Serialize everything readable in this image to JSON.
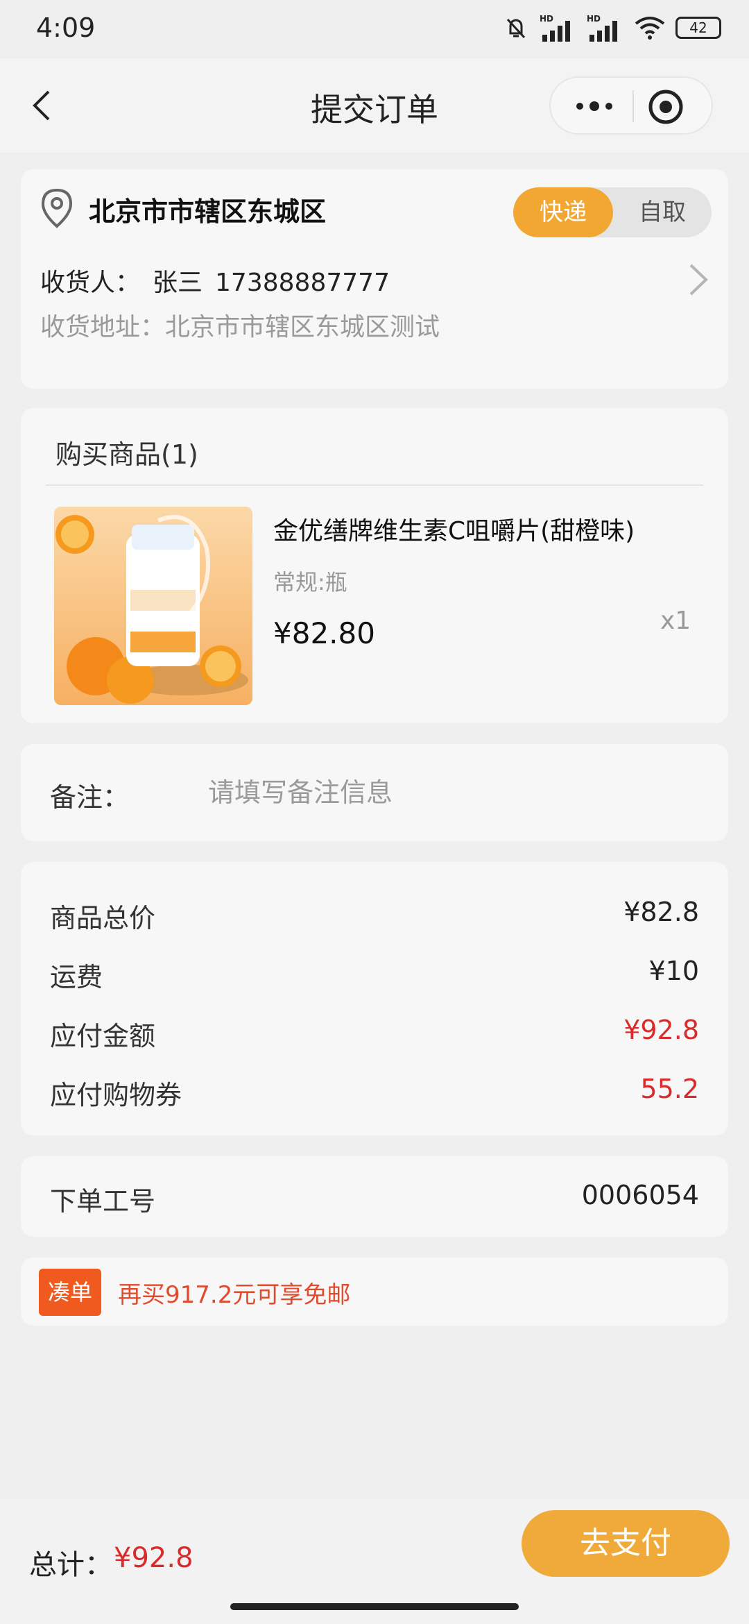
{
  "status_bar": {
    "time": "4:09",
    "network_1": "HD",
    "network_2": "HD",
    "battery": "42"
  },
  "nav": {
    "title": "提交订单",
    "icons": [
      "chevron-left-icon",
      "more-icon",
      "target-icon"
    ]
  },
  "address": {
    "region": "北京市市辖区东城区",
    "delivery_options": [
      "快递",
      "自取"
    ],
    "selected_option": "快递",
    "receiver_label": "收货人：",
    "receiver_name": "张三",
    "receiver_phone": "17388887777",
    "address_text": "收货地址：北京市市辖区东城区测试"
  },
  "goods": {
    "header": "购买商品(1)",
    "items": [
      {
        "name": "金优缮牌维生素C咀嚼片(甜橙味)",
        "spec": "常规:瓶",
        "price": "¥82.80",
        "qty": "x1"
      }
    ]
  },
  "remark": {
    "label": "备注：",
    "placeholder": "请填写备注信息",
    "value": ""
  },
  "price_summary": [
    {
      "label": "商品总价",
      "value": "¥82.8",
      "highlight": false
    },
    {
      "label": "运费",
      "value": "¥10",
      "highlight": false
    },
    {
      "label": "应付金额",
      "value": "¥92.8",
      "highlight": true
    },
    {
      "label": "应付购物券",
      "value": "55.2",
      "highlight": true
    }
  ],
  "worker": {
    "label": "下单工号",
    "value": "0006054"
  },
  "tip": {
    "badge": "凑单",
    "text": "再买917.2元可享免邮"
  },
  "footer": {
    "total_label": "总计：",
    "total_value": "¥92.8",
    "pay_button": "去支付"
  },
  "colors": {
    "accent_orange": "#f2a733",
    "price_red": "#d92b2b",
    "badge_orange": "#f05a1e"
  }
}
